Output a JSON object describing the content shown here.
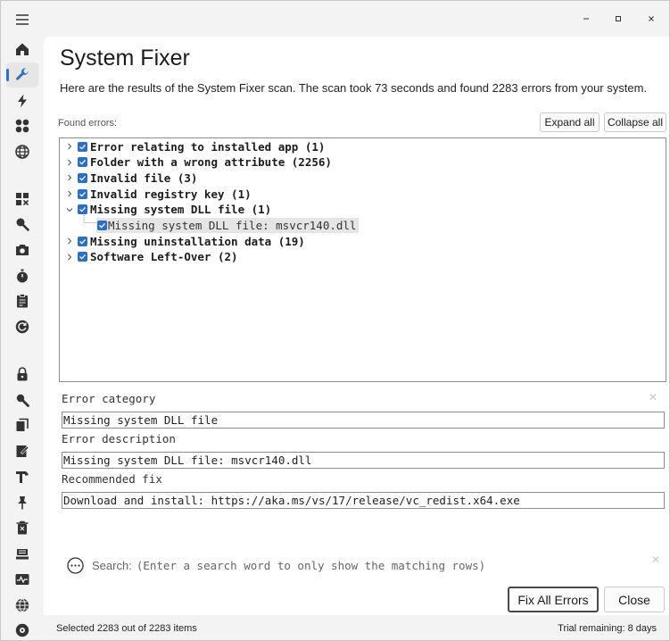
{
  "header": {
    "title": "System Fixer",
    "description": "Here are the results of the System Fixer scan. The scan took 73 seconds and found 2283 errors from your system."
  },
  "found_errors_label": "Found errors:",
  "buttons": {
    "expand_all": "Expand all",
    "collapse_all": "Collapse all",
    "fix_all": "Fix All Errors",
    "close": "Close"
  },
  "tree": [
    {
      "label": "Error relating to installed app (1)",
      "expanded": false
    },
    {
      "label": "Folder with a wrong attribute (2256)",
      "expanded": false
    },
    {
      "label": "Invalid file (3)",
      "expanded": false
    },
    {
      "label": "Invalid registry key (1)",
      "expanded": false
    },
    {
      "label": "Missing system DLL file (1)",
      "expanded": true,
      "children": [
        {
          "label": "Missing system DLL file: msvcr140.dll",
          "selected": true
        }
      ]
    },
    {
      "label": "Missing uninstallation data (19)",
      "expanded": false
    },
    {
      "label": "Software Left-Over (2)",
      "expanded": false
    }
  ],
  "details": {
    "category_label": "Error category",
    "category_value": "Missing system DLL file",
    "description_label": "Error description",
    "description_value": "Missing system DLL file: msvcr140.dll",
    "fix_label": "Recommended fix",
    "fix_value": "Download and install: https://aka.ms/vs/17/release/vc_redist.x64.exe"
  },
  "search": {
    "label": "Search:",
    "placeholder": "(Enter a search word to only show the matching rows)"
  },
  "status": {
    "selected": "Selected 2283 out of 2283 items",
    "trial": "Trial remaining: 8 days"
  },
  "colors": {
    "accent": "#2f6fbf",
    "selection": "#e5e5e5"
  },
  "sidebar": {
    "icons": [
      "hamburger-icon",
      "home-icon",
      "wrench-icon",
      "bolt-icon",
      "apps-icon",
      "globe-icon",
      "grid-icon",
      "magnifier-icon",
      "camera-icon",
      "stopwatch-icon",
      "clipboard-icon",
      "refresh-icon",
      "lock-icon",
      "search-icon",
      "copy-icon",
      "edit-icon",
      "hammer-icon",
      "pin-icon",
      "trash-icon",
      "drive-icon",
      "pulse-icon",
      "globe-alt-icon",
      "disk-icon"
    ],
    "active": "wrench-icon"
  }
}
